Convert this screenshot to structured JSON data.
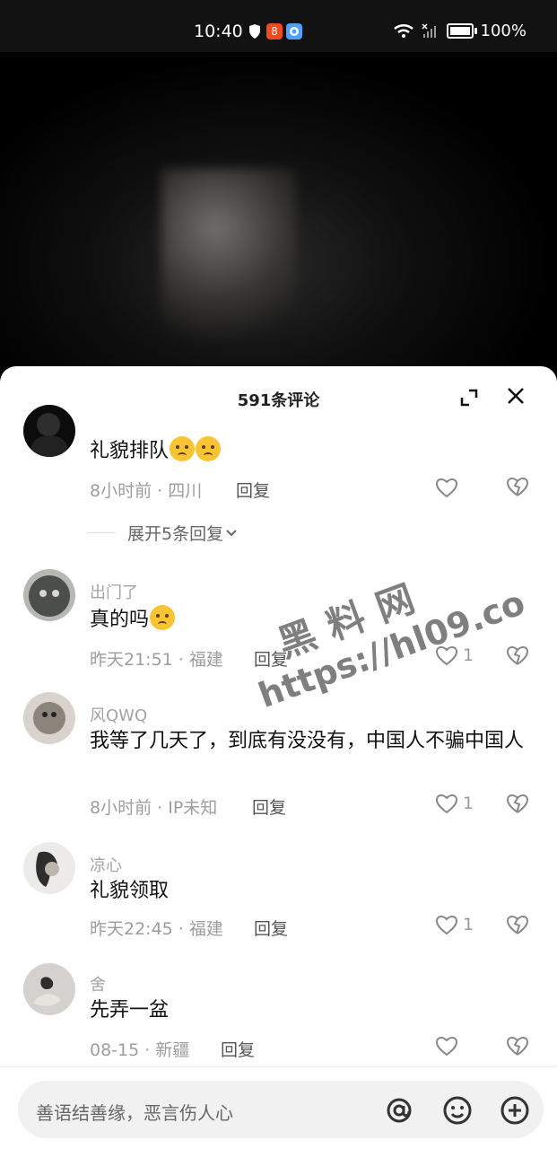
{
  "status_bar": {
    "time": "10:40",
    "battery": "100%",
    "tiktok_badge": "8"
  },
  "comments_sheet": {
    "title": "591条评论",
    "expand_replies": "展开5条回复",
    "comments": [
      {
        "username": "",
        "text": "礼貌排队",
        "time": "8小时前",
        "location": "四川",
        "reply_label": "回复",
        "likes": ""
      },
      {
        "username": "出门了",
        "text": "真的吗",
        "time": "昨天21:51",
        "location": "福建",
        "reply_label": "回复",
        "likes": "1"
      },
      {
        "username": "风QWQ",
        "text": "我等了几天了，到底有没没有，中国人不骗中国人",
        "time": "8小时前",
        "location": "IP未知",
        "reply_label": "回复",
        "likes": "1"
      },
      {
        "username": "凉心",
        "text": "礼貌领取",
        "time": "昨天22:45",
        "location": "福建",
        "reply_label": "回复",
        "likes": "1"
      },
      {
        "username": "舍",
        "text": "先弄一盆",
        "time": "08-15",
        "location": "新疆",
        "reply_label": "回复",
        "likes": ""
      }
    ]
  },
  "input_bar": {
    "placeholder": "善语结善缘，恶言伤人心"
  },
  "watermark": {
    "line1": "黑料网",
    "line2": "https://hl09.co"
  },
  "colors": {
    "sheet_bg": "#ffffff",
    "muted": "#9d9d9d",
    "text": "#111111",
    "input_bg": "#f1f1f1"
  }
}
